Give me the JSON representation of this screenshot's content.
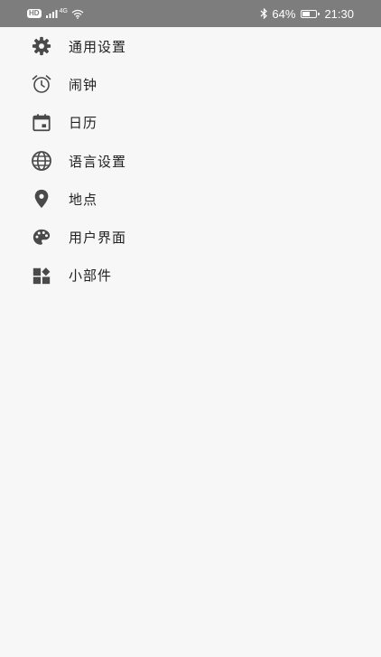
{
  "status_bar": {
    "hd_badge": "HD",
    "signal_label": "4G",
    "battery_percent_text": "64%",
    "battery_level": 0.64,
    "time": "21:30"
  },
  "menu": {
    "items": [
      {
        "label": "通用设置",
        "icon": "gear-icon"
      },
      {
        "label": "闹钟",
        "icon": "alarm-clock-icon"
      },
      {
        "label": "日历",
        "icon": "calendar-icon"
      },
      {
        "label": "语言设置",
        "icon": "globe-icon"
      },
      {
        "label": "地点",
        "icon": "location-pin-icon"
      },
      {
        "label": "用户界面",
        "icon": "palette-icon"
      },
      {
        "label": "小部件",
        "icon": "widgets-icon"
      }
    ]
  },
  "colors": {
    "status_bar_bg": "#7d7d7d",
    "background": "#f7f7f7",
    "icon": "#4a4a4a",
    "text": "#222222"
  }
}
